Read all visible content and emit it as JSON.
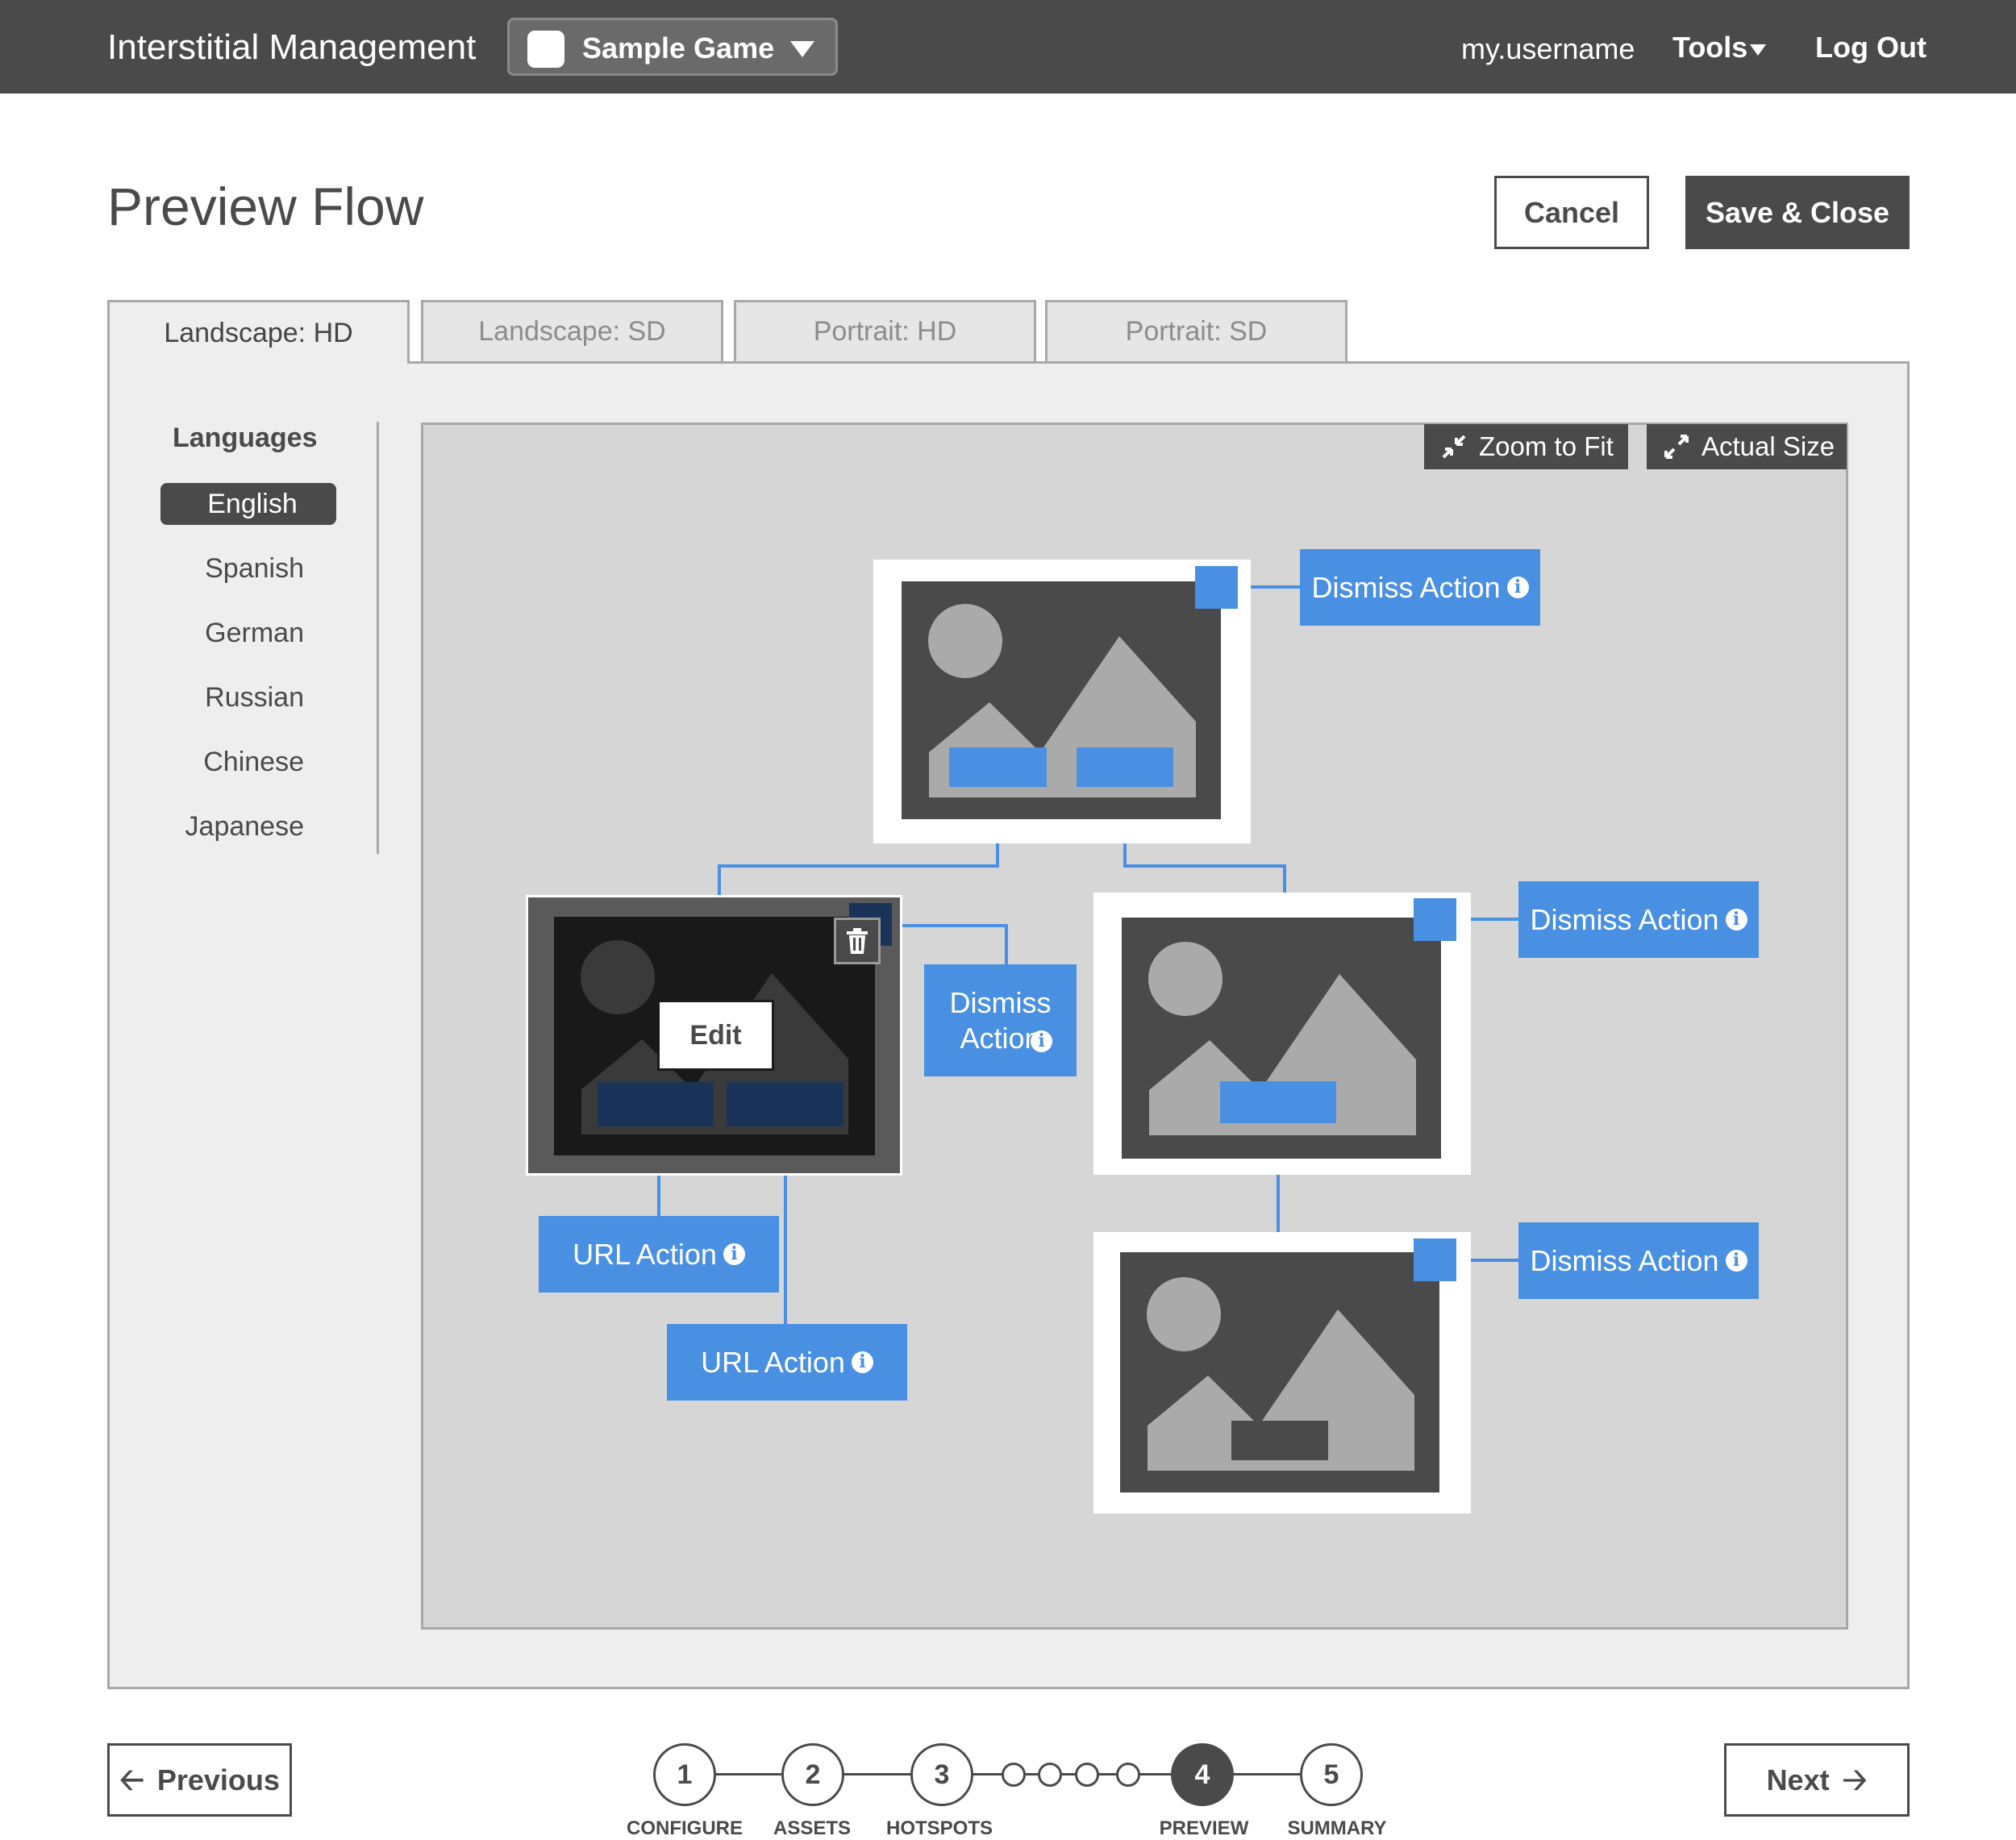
{
  "app": {
    "title": "Interstitial Management",
    "game_name": "Sample Game",
    "username": "my.username",
    "tools_label": "Tools",
    "logout_label": "Log Out"
  },
  "header": {
    "title": "Preview Flow",
    "cancel_label": "Cancel",
    "save_label": "Save & Close"
  },
  "tabs": [
    {
      "label": "Landscape: HD",
      "active": true
    },
    {
      "label": "Landscape: SD",
      "active": false
    },
    {
      "label": "Portrait: HD",
      "active": false
    },
    {
      "label": "Portrait: SD",
      "active": false
    }
  ],
  "languages": {
    "heading": "Languages",
    "items": [
      "English",
      "Spanish",
      "German",
      "Russian",
      "Chinese",
      "Japanese"
    ],
    "selected": "English"
  },
  "canvas": {
    "zoom_to_fit_label": "Zoom to Fit",
    "actual_size_label": "Actual Size",
    "edit_label": "Edit",
    "actions": {
      "dismiss_top": "Dismiss Action",
      "dismiss_mid_left": "Dismiss Action",
      "dismiss_mid_right": "Dismiss Action",
      "dismiss_bottom": "Dismiss Action",
      "url_1": "URL Action",
      "url_2": "URL Action"
    },
    "info_glyph": "i"
  },
  "footer": {
    "previous_label": "Previous",
    "next_label": "Next",
    "steps": [
      {
        "number": "1",
        "label": "CONFIGURE"
      },
      {
        "number": "2",
        "label": "ASSETS"
      },
      {
        "number": "3",
        "label": "HOTSPOTS"
      },
      {
        "number": "4",
        "label": "PREVIEW"
      },
      {
        "number": "5",
        "label": "SUMMARY"
      }
    ],
    "current_step": 4
  },
  "colors": {
    "topbar": "#4a4a4a",
    "accent": "#4a90e2",
    "panel": "#eeeeee",
    "canvas": "#d6d6d6"
  }
}
